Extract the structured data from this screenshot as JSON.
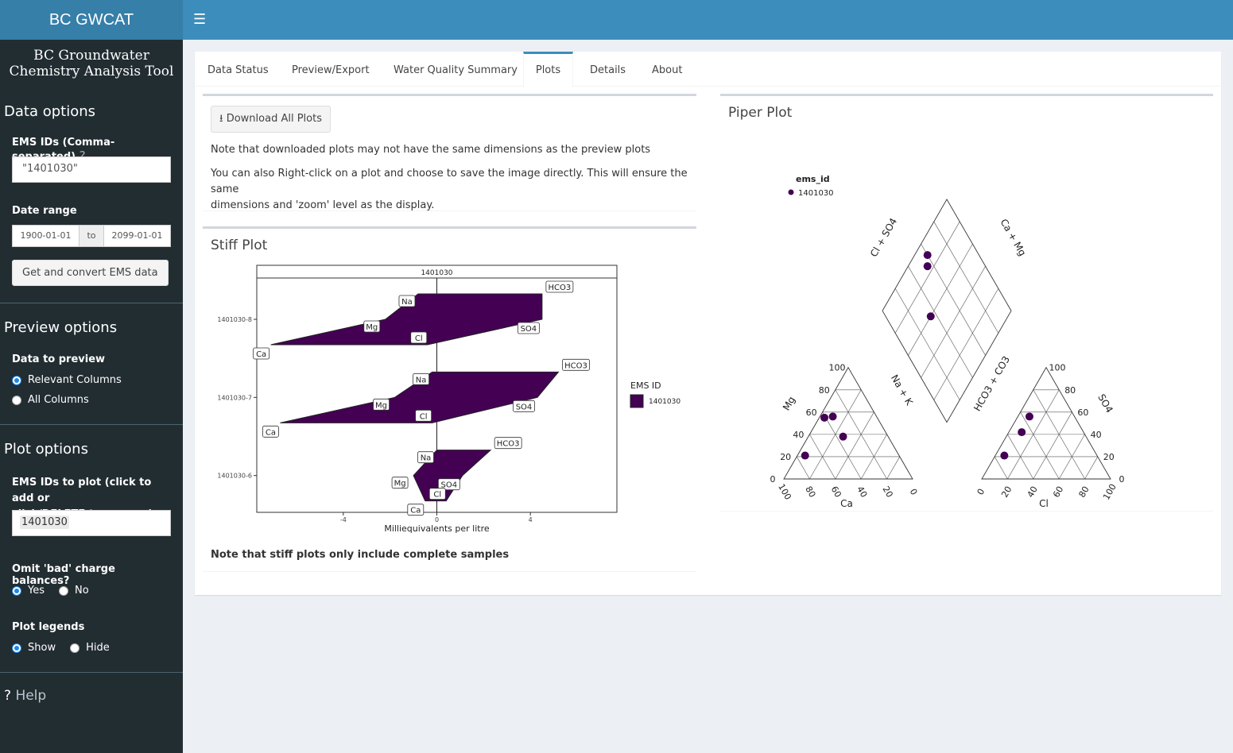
{
  "sidebar": {
    "logo": "BC GWCAT",
    "app_title_1": "BC Groundwater",
    "app_title_2": "Chemistry Analysis Tool",
    "data_options": {
      "heading": "Data options",
      "ems_ids_label": "EMS IDs (Comma-separated)",
      "help_mark": "?",
      "ems_ids_value": "\"1401030\"",
      "date_range_label": "Date range",
      "date_start": "1900-01-01",
      "date_to": "to",
      "date_end": "2099-01-01",
      "get_button": "Get and convert EMS data"
    },
    "preview_options": {
      "heading": "Preview options",
      "data_to_preview_label": "Data to preview",
      "opt_relevant": "Relevant Columns",
      "opt_all": "All Columns",
      "selected": "Relevant Columns"
    },
    "plot_options": {
      "heading": "Plot options",
      "ems_plot_label_1": "EMS IDs to plot (click to add or",
      "ems_plot_label_2": "click/DELETE to remove)",
      "ems_plot_tag": "1401030",
      "omit_label": "Omit 'bad' charge balances?",
      "yes": "Yes",
      "no": "No",
      "legends_label": "Plot legends",
      "show": "Show",
      "hide": "Hide"
    },
    "help": "Help"
  },
  "header": {
    "menu_icon": "hamburger-icon"
  },
  "tabs": [
    "Data Status",
    "Preview/Export",
    "Water Quality Summary",
    "Plots",
    "Details",
    "About"
  ],
  "active_tab": "Plots",
  "plots": {
    "download_button": "Download All Plots",
    "note1": "Note that downloaded plots may not have the same dimensions as the preview plots",
    "note2a": "You can also Right-click on a plot and choose to save the image directly. This will ensure the same",
    "note2b": "dimensions and 'zoom' level as the display.",
    "stiff_title": "Stiff Plot",
    "stiff_footer": "Note that stiff plots only include complete samples",
    "piper_title": "Piper Plot"
  },
  "chart_data": [
    {
      "type": "area",
      "title": "Stiff Plot",
      "facet": "1401030",
      "xlabel": "Milliequivalents per litre",
      "xticks": [
        "-4",
        "0",
        "4"
      ],
      "xlim": [
        -7.7,
        7.7
      ],
      "legend_title": "EMS ID",
      "legend_entry": "1401030",
      "fill": "#440154",
      "samples": [
        {
          "name": "1401030-8",
          "cations": {
            "Na": -0.8,
            "Ca": -7.1,
            "Mg": -2.2
          },
          "anions": {
            "HCO3": 4.5,
            "SO4": 4.5,
            "Cl": -0.4
          }
        },
        {
          "name": "1401030-7",
          "cations": {
            "Na": -0.2,
            "Ca": -6.7,
            "Mg": -1.8
          },
          "anions": {
            "HCO3": 5.2,
            "SO4": 4.3,
            "Cl": -0.2
          }
        },
        {
          "name": "1401030-6",
          "cations": {
            "Na": 0.0,
            "Ca": -0.5,
            "Mg": -1.0
          },
          "anions": {
            "HCO3": 2.3,
            "SO4": 1.1,
            "Cl": 0.4
          }
        }
      ]
    },
    {
      "type": "scatter",
      "title": "Piper Plot",
      "legend_title": "ems_id",
      "legend_entry": "1401030",
      "color": "#440154",
      "cation_axes": [
        "Mg",
        "Ca",
        "Na + K"
      ],
      "anion_axes": [
        "SO4",
        "Cl",
        "HCO3 + CO3"
      ],
      "diamond_axes": [
        "Cl + SO4",
        "Ca + Mg"
      ],
      "ticks": [
        "0",
        "20",
        "40",
        "60",
        "80",
        "100"
      ],
      "cation_points": [
        {
          "Mg": 21,
          "Ca": 73,
          "NaK": 6
        },
        {
          "Mg": 55,
          "Ca": 41,
          "NaK": 4
        },
        {
          "Mg": 56,
          "Ca": 34,
          "NaK": 10
        },
        {
          "Mg": 38,
          "Ca": 35,
          "NaK": 27
        }
      ],
      "anion_points": [
        {
          "SO4": 21,
          "Cl": 7,
          "HCO3": 72
        },
        {
          "SO4": 56,
          "Cl": 9,
          "HCO3": 35
        },
        {
          "SO4": 42,
          "Cl": 10,
          "HCO3": 48
        }
      ],
      "diamond_points": [
        {
          "ClSO4": 35,
          "CaMg": 60
        },
        {
          "ClSO4": 55,
          "CaMg": 85
        },
        {
          "ClSO4": 60,
          "CaMg": 90
        }
      ]
    }
  ]
}
